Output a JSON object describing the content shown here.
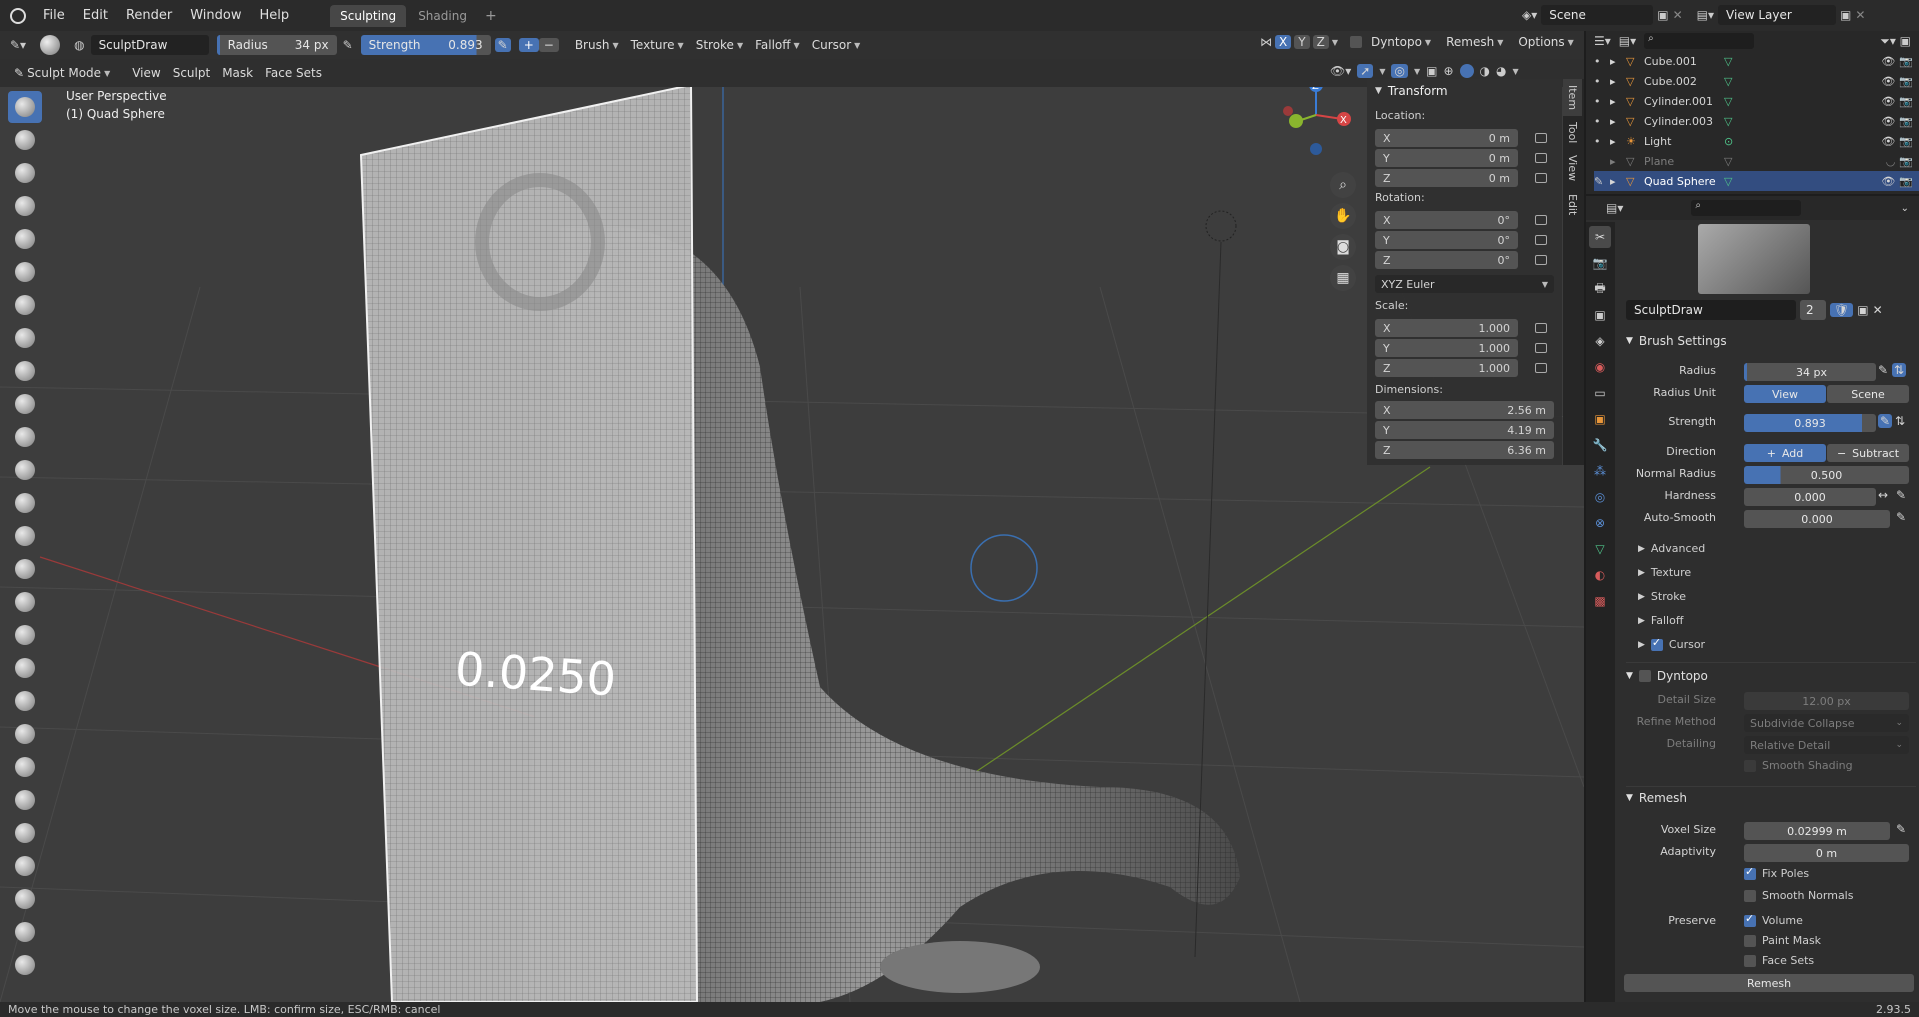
{
  "app": {
    "logo": "blender-logo-icon"
  },
  "menu": [
    "File",
    "Edit",
    "Render",
    "Window",
    "Help"
  ],
  "workspace_tabs": [
    {
      "label": "Sculpting",
      "active": true
    },
    {
      "label": "Shading",
      "active": false
    }
  ],
  "scene": {
    "name": "Scene",
    "view_layer": "View Layer"
  },
  "toolhdr": {
    "brush_name": "SculptDraw",
    "radius_label": "Radius",
    "radius_value": "34 px",
    "strength_label": "Strength",
    "strength_value": "0.893",
    "menus": [
      "Brush",
      "Texture",
      "Stroke",
      "Falloff",
      "Cursor"
    ],
    "axes": [
      "X",
      "Y",
      "Z"
    ],
    "right_menus": [
      "Dyntopo",
      "Remesh",
      "Options"
    ]
  },
  "modehdr": {
    "mode": "Sculpt Mode",
    "menus": [
      "View",
      "Sculpt",
      "Mask",
      "Face Sets"
    ]
  },
  "viewport": {
    "perspective": "User Perspective",
    "object": "(1) Quad Sphere",
    "overlay_value": "0.0250",
    "accent": "#4772b3"
  },
  "npanel": {
    "title": "Transform",
    "location_label": "Location:",
    "location": [
      {
        "axis": "X",
        "value": "0 m"
      },
      {
        "axis": "Y",
        "value": "0 m"
      },
      {
        "axis": "Z",
        "value": "0 m"
      }
    ],
    "rotation_label": "Rotation:",
    "rotation": [
      {
        "axis": "X",
        "value": "0°"
      },
      {
        "axis": "Y",
        "value": "0°"
      },
      {
        "axis": "Z",
        "value": "0°"
      }
    ],
    "rotation_mode": "XYZ Euler",
    "scale_label": "Scale:",
    "scale": [
      {
        "axis": "X",
        "value": "1.000"
      },
      {
        "axis": "Y",
        "value": "1.000"
      },
      {
        "axis": "Z",
        "value": "1.000"
      }
    ],
    "dimensions_label": "Dimensions:",
    "dimensions": [
      {
        "axis": "X",
        "value": "2.56 m"
      },
      {
        "axis": "Y",
        "value": "4.19 m"
      },
      {
        "axis": "Z",
        "value": "6.36 m"
      }
    ],
    "tabs": [
      "Item",
      "Tool",
      "View",
      "Edit"
    ]
  },
  "outliner": {
    "items": [
      {
        "name": "Cube.001",
        "icon": "mesh-icon",
        "dim": false
      },
      {
        "name": "Cube.002",
        "icon": "mesh-icon",
        "dim": false
      },
      {
        "name": "Cylinder.001",
        "icon": "mesh-icon",
        "dim": false
      },
      {
        "name": "Cylinder.003",
        "icon": "mesh-icon",
        "dim": false
      },
      {
        "name": "Light",
        "icon": "light-icon",
        "dim": false
      },
      {
        "name": "Plane",
        "icon": "mesh-icon",
        "dim": true
      },
      {
        "name": "Quad Sphere",
        "icon": "mesh-icon",
        "dim": false
      }
    ]
  },
  "props": {
    "brush_name": "SculptDraw",
    "users": "2",
    "brush_settings": "Brush Settings",
    "radius_label": "Radius",
    "radius": "34 px",
    "radius_unit_label": "Radius Unit",
    "radius_unit_view": "View",
    "radius_unit_scene": "Scene",
    "strength_label": "Strength",
    "strength": "0.893",
    "direction_label": "Direction",
    "dir_add": "Add",
    "dir_sub": "Subtract",
    "normal_radius_label": "Normal Radius",
    "normal_radius": "0.500",
    "hardness_label": "Hardness",
    "hardness": "0.000",
    "autosmooth_label": "Auto-Smooth",
    "autosmooth": "0.000",
    "subpanels": [
      "Advanced",
      "Texture",
      "Stroke",
      "Falloff"
    ],
    "cursor_label": "Cursor",
    "dyntopo": "Dyntopo",
    "detail_size_label": "Detail Size",
    "detail_size": "12.00 px",
    "refine_label": "Refine Method",
    "refine": "Subdivide Collapse",
    "detailing_label": "Detailing",
    "detailing": "Relative Detail",
    "smooth_shading": "Smooth Shading",
    "remesh": "Remesh",
    "voxel_label": "Voxel Size",
    "voxel": "0.02999 m",
    "adapt_label": "Adaptivity",
    "adapt": "0 m",
    "fix_poles": "Fix Poles",
    "smooth_normals": "Smooth Normals",
    "preserve_label": "Preserve",
    "volume": "Volume",
    "paint_mask": "Paint Mask",
    "face_sets": "Face Sets",
    "remesh_button": "Remesh"
  },
  "status": {
    "hint": "Move the mouse to change the voxel size. LMB: confirm size, ESC/RMB: cancel",
    "version": "2.93.5"
  }
}
